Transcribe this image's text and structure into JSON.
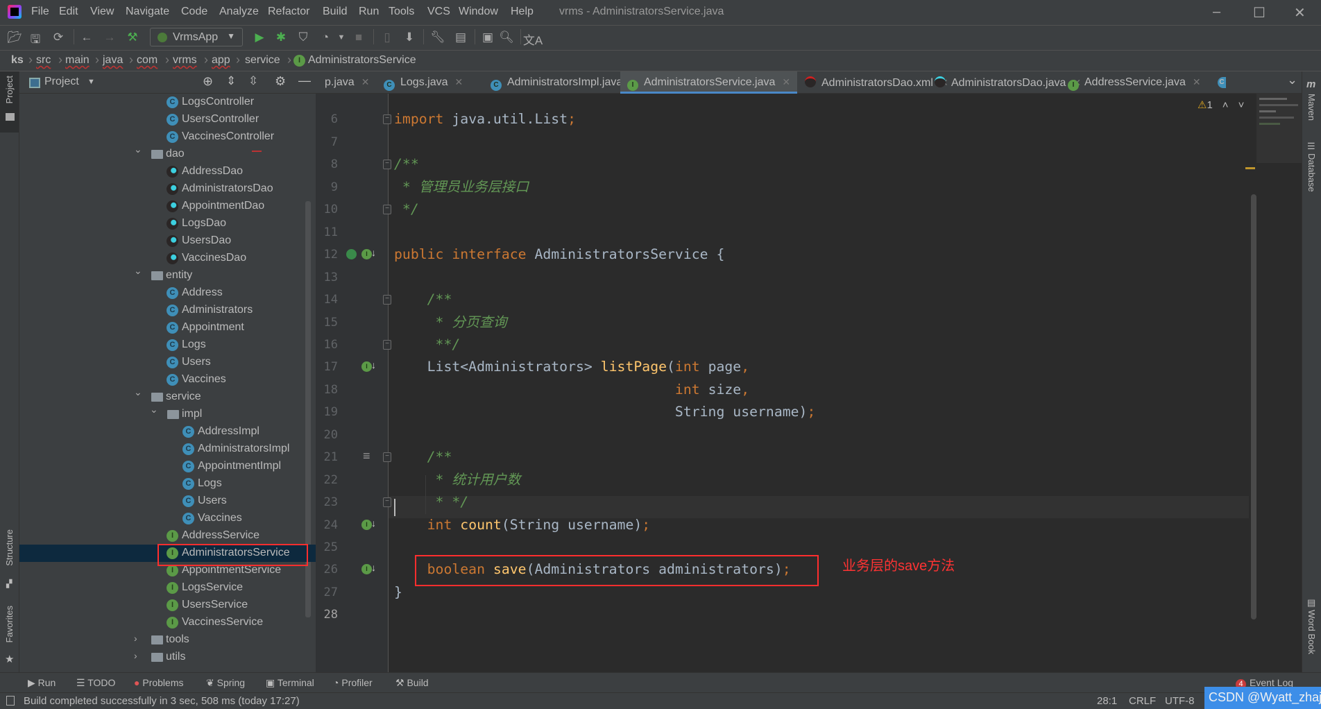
{
  "app": {
    "title": "vrms - AdministratorsService.java"
  },
  "menu": [
    "File",
    "Edit",
    "View",
    "Navigate",
    "Code",
    "Analyze",
    "Refactor",
    "Build",
    "Run",
    "Tools",
    "VCS",
    "Window",
    "Help"
  ],
  "toolbar": {
    "run_config": "VrmsApp"
  },
  "breadcrumb": [
    "ks",
    "src",
    "main",
    "java",
    "com",
    "vrms",
    "app",
    "service",
    "AdministratorsService"
  ],
  "project": {
    "title": "Project",
    "tree": [
      {
        "label": "LogsController",
        "type": "class",
        "depth": 3
      },
      {
        "label": "UsersController",
        "type": "class",
        "depth": 3
      },
      {
        "label": "VaccinesController",
        "type": "class",
        "depth": 3
      },
      {
        "label": "dao",
        "type": "folder",
        "depth": 2,
        "open": true
      },
      {
        "label": "AddressDao",
        "type": "mapper",
        "depth": 3
      },
      {
        "label": "AdministratorsDao",
        "type": "mapper",
        "depth": 3
      },
      {
        "label": "AppointmentDao",
        "type": "mapper",
        "depth": 3
      },
      {
        "label": "LogsDao",
        "type": "mapper",
        "depth": 3
      },
      {
        "label": "UsersDao",
        "type": "mapper",
        "depth": 3
      },
      {
        "label": "VaccinesDao",
        "type": "mapper",
        "depth": 3
      },
      {
        "label": "entity",
        "type": "folder",
        "depth": 2,
        "open": true
      },
      {
        "label": "Address",
        "type": "class",
        "depth": 3
      },
      {
        "label": "Administrators",
        "type": "class",
        "depth": 3
      },
      {
        "label": "Appointment",
        "type": "class",
        "depth": 3
      },
      {
        "label": "Logs",
        "type": "class",
        "depth": 3
      },
      {
        "label": "Users",
        "type": "class",
        "depth": 3
      },
      {
        "label": "Vaccines",
        "type": "class",
        "depth": 3
      },
      {
        "label": "service",
        "type": "folder",
        "depth": 2,
        "open": true
      },
      {
        "label": "impl",
        "type": "folder",
        "depth": 3,
        "open": true
      },
      {
        "label": "AddressImpl",
        "type": "class",
        "depth": 4
      },
      {
        "label": "AdministratorsImpl",
        "type": "class",
        "depth": 4
      },
      {
        "label": "AppointmentImpl",
        "type": "class",
        "depth": 4
      },
      {
        "label": "Logs",
        "type": "class",
        "depth": 4
      },
      {
        "label": "Users",
        "type": "class",
        "depth": 4
      },
      {
        "label": "Vaccines",
        "type": "class",
        "depth": 4
      },
      {
        "label": "AddressService",
        "type": "interface",
        "depth": 3
      },
      {
        "label": "AdministratorsService",
        "type": "interface",
        "depth": 3,
        "selected": true
      },
      {
        "label": "AppointmentService",
        "type": "interface",
        "depth": 3
      },
      {
        "label": "LogsService",
        "type": "interface",
        "depth": 3
      },
      {
        "label": "UsersService",
        "type": "interface",
        "depth": 3
      },
      {
        "label": "VaccinesService",
        "type": "interface",
        "depth": 3
      },
      {
        "label": "tools",
        "type": "folder",
        "depth": 2,
        "open": false
      },
      {
        "label": "utils",
        "type": "folder",
        "depth": 2,
        "open": false
      }
    ]
  },
  "tabs": [
    {
      "label": "p.java",
      "icon": "none"
    },
    {
      "label": "Logs.java",
      "icon": "class"
    },
    {
      "label": "AdministratorsImpl.java",
      "icon": "class"
    },
    {
      "label": "AdministratorsService.java",
      "icon": "interface",
      "active": true
    },
    {
      "label": "AdministratorsDao.xml",
      "icon": "mapper-xml"
    },
    {
      "label": "AdministratorsDao.java",
      "icon": "mapper"
    },
    {
      "label": "AddressService.java",
      "icon": "interface"
    }
  ],
  "editor": {
    "warnings": "1",
    "current_line": 28,
    "lines": [
      {
        "n": 5,
        "tokens": []
      },
      {
        "n": 6,
        "tokens": [
          [
            "kw",
            "import "
          ],
          [
            "pl",
            "java.util.List"
          ],
          [
            "kw",
            ";"
          ]
        ]
      },
      {
        "n": 7,
        "tokens": []
      },
      {
        "n": 8,
        "tokens": [
          [
            "cm",
            "/**"
          ]
        ]
      },
      {
        "n": 9,
        "tokens": [
          [
            "cm",
            " * 管理员业务层接口"
          ]
        ]
      },
      {
        "n": 10,
        "tokens": [
          [
            "cm",
            " */"
          ]
        ]
      },
      {
        "n": 11,
        "tokens": []
      },
      {
        "n": 12,
        "tokens": [
          [
            "kw",
            "public interface "
          ],
          [
            "pl",
            "AdministratorsService {"
          ]
        ]
      },
      {
        "n": 13,
        "tokens": []
      },
      {
        "n": 14,
        "tokens": [
          [
            "cm",
            "    /**"
          ]
        ]
      },
      {
        "n": 15,
        "tokens": [
          [
            "cm",
            "     * 分页查询"
          ]
        ]
      },
      {
        "n": 16,
        "tokens": [
          [
            "cm",
            "     **/"
          ]
        ]
      },
      {
        "n": 17,
        "tokens": [
          [
            "pl",
            "    List<Administrators> "
          ],
          [
            "fn",
            "listPage"
          ],
          [
            "pl",
            "("
          ],
          [
            "kw",
            "int "
          ],
          [
            "pl",
            "page"
          ],
          [
            "kw",
            ","
          ]
        ]
      },
      {
        "n": 18,
        "tokens": [
          [
            "pl",
            "                                  "
          ],
          [
            "kw",
            "int "
          ],
          [
            "pl",
            "size"
          ],
          [
            "kw",
            ","
          ]
        ]
      },
      {
        "n": 19,
        "tokens": [
          [
            "pl",
            "                                  String username)"
          ],
          [
            "kw",
            ";"
          ]
        ]
      },
      {
        "n": 20,
        "tokens": []
      },
      {
        "n": 21,
        "tokens": [
          [
            "cm",
            "    /**"
          ]
        ]
      },
      {
        "n": 22,
        "tokens": [
          [
            "cm",
            "     * 统计用户数"
          ]
        ]
      },
      {
        "n": 23,
        "tokens": [
          [
            "cm",
            "     * */"
          ]
        ]
      },
      {
        "n": 24,
        "tokens": [
          [
            "kw",
            "    int "
          ],
          [
            "fn",
            "count"
          ],
          [
            "pl",
            "(String username)"
          ],
          [
            "kw",
            ";"
          ]
        ]
      },
      {
        "n": 25,
        "tokens": []
      },
      {
        "n": 26,
        "tokens": [
          [
            "kw",
            "    boolean "
          ],
          [
            "fn",
            "save"
          ],
          [
            "pl",
            "(Administrators administrators)"
          ],
          [
            "kw",
            ";"
          ]
        ]
      },
      {
        "n": 27,
        "tokens": [
          [
            "pl",
            "}"
          ]
        ]
      },
      {
        "n": 28,
        "tokens": []
      }
    ],
    "annotation": "业务层的save方法"
  },
  "left_strip": [
    "Project",
    "Structure",
    "Favorites"
  ],
  "right_strip": [
    "Maven",
    "Database",
    "Word Book"
  ],
  "bottom_tools": [
    "Run",
    "TODO",
    "Problems",
    "Spring",
    "Terminal",
    "Profiler",
    "Build"
  ],
  "event_log": {
    "label": "Event Log",
    "count": "4"
  },
  "status": {
    "message": "Build completed successfully in 3 sec, 508 ms (today 17:27)",
    "position": "28:1",
    "line_sep": "CRLF",
    "encoding": "UTF-8"
  },
  "watermark": "CSDN @Wyatt_zhaj",
  "colors": {
    "keyword": "#cc7832",
    "method": "#ffc66d",
    "comment": "#629755",
    "annotation_red": "#ff2e2e",
    "selection": "#0d293e",
    "tab_underline": "#4a88c7"
  }
}
